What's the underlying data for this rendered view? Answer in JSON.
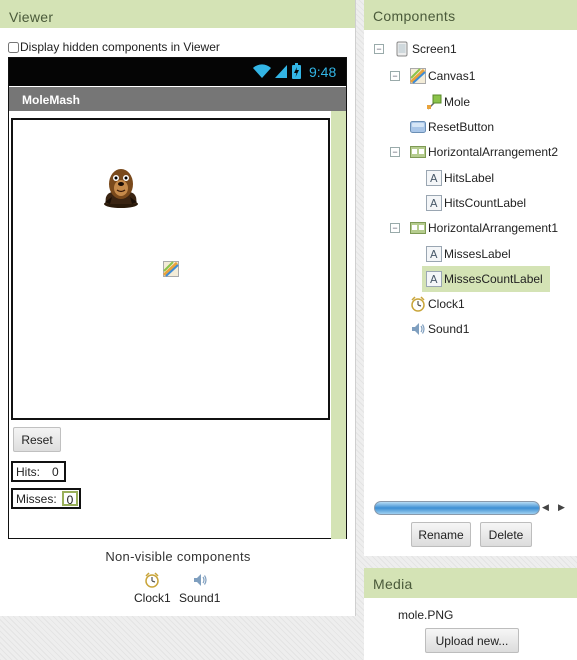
{
  "viewer": {
    "header": "Viewer",
    "hidden_toggle_label": "Display hidden components in Viewer",
    "status_time": "9:48",
    "app_title": "MoleMash",
    "reset_label": "Reset",
    "hits_label": "Hits:",
    "hits_value": "0",
    "misses_label": "Misses:",
    "misses_value": "0",
    "nonvisible_title": "Non-visible components",
    "nonvisible": [
      {
        "name": "Clock1",
        "icon": "clock-icon"
      },
      {
        "name": "Sound1",
        "icon": "speaker-icon"
      }
    ]
  },
  "components": {
    "header": "Components",
    "tree": [
      {
        "label": "Screen1",
        "icon": "screen-icon",
        "level": 0,
        "expanded": true
      },
      {
        "label": "Canvas1",
        "icon": "canvas-icon",
        "level": 1,
        "expanded": true
      },
      {
        "label": "Mole",
        "icon": "imagesprite-icon",
        "level": 2
      },
      {
        "label": "ResetButton",
        "icon": "button-icon",
        "level": 1
      },
      {
        "label": "HorizontalArrangement2",
        "icon": "arrangement-icon",
        "level": 1,
        "expanded": true
      },
      {
        "label": "HitsLabel",
        "icon": "label-icon",
        "level": 2
      },
      {
        "label": "HitsCountLabel",
        "icon": "label-icon",
        "level": 2
      },
      {
        "label": "HorizontalArrangement1",
        "icon": "arrangement-icon",
        "level": 1,
        "expanded": true
      },
      {
        "label": "MissesLabel",
        "icon": "label-icon",
        "level": 2
      },
      {
        "label": "MissesCountLabel",
        "icon": "label-icon",
        "level": 2,
        "selected": true
      },
      {
        "label": "Clock1",
        "icon": "clock-icon",
        "level": 1
      },
      {
        "label": "Sound1",
        "icon": "speaker-icon",
        "level": 1
      }
    ],
    "rename_label": "Rename",
    "delete_label": "Delete"
  },
  "media": {
    "header": "Media",
    "files": [
      "mole.PNG"
    ],
    "upload_label": "Upload new..."
  },
  "colors": {
    "header_bg": "#d4e3b5",
    "selected_bg": "#d4e3b5",
    "status_time": "#33b5e5",
    "titlebar_bg": "#767676"
  }
}
